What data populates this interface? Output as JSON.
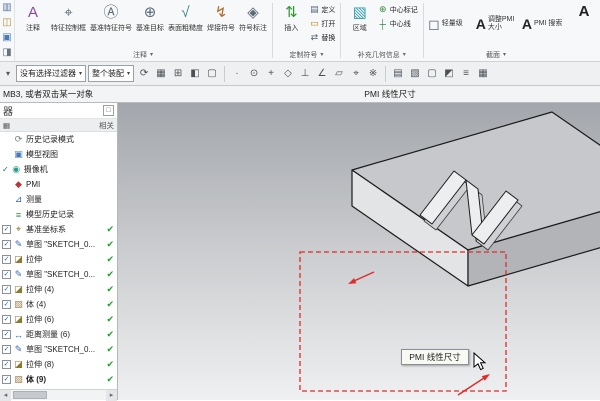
{
  "ribbon": {
    "mini_icons": [
      {
        "icon": "new-part-icon",
        "glyph": "▥",
        "color": "#5b78a8"
      },
      {
        "icon": "open-part-icon",
        "glyph": "◫",
        "color": "#b8913a"
      },
      {
        "icon": "save-part-icon",
        "glyph": "▣",
        "color": "#4a7ab5"
      },
      {
        "icon": "window-switch-icon",
        "glyph": "◨",
        "color": "#6b7480"
      }
    ],
    "annotation_group": {
      "label": "注释",
      "items": [
        {
          "name": "annotation-note-button",
          "icon": "note-a-icon",
          "glyph": "A",
          "color": "#8a4a9a",
          "label": "注释"
        },
        {
          "name": "feature-control-frame-button",
          "icon": "feature-control-frame-icon",
          "glyph": "⌖",
          "color": "#5b6b7a",
          "label": "特征控制框"
        },
        {
          "name": "datum-feature-symbol-button",
          "icon": "datum-feature-icon",
          "glyph": "Ⓐ",
          "color": "#5b6b7a",
          "label": "基准特征符号"
        },
        {
          "name": "datum-target-button",
          "icon": "datum-target-icon",
          "glyph": "⊕",
          "color": "#5b6b7a",
          "label": "基准目标"
        },
        {
          "name": "surface-finish-button",
          "icon": "surface-finish-icon",
          "glyph": "√",
          "color": "#3a8a8a",
          "label": "表面粗糙度"
        },
        {
          "name": "weld-symbol-button",
          "icon": "weld-symbol-icon",
          "glyph": "↯",
          "color": "#b06a2a",
          "label": "焊接符号"
        },
        {
          "name": "symbol-callout-button",
          "icon": "symbol-callout-icon",
          "glyph": "◈",
          "color": "#5b6b7a",
          "label": "符号标注"
        }
      ]
    },
    "custom_symbol_group": {
      "label": "定制符号",
      "big": {
        "label": "插入",
        "glyph": "⇅",
        "color": "#2e9a2e"
      },
      "small_items": [
        {
          "name": "define-symbol-button",
          "icon": "define-icon",
          "glyph": "▤",
          "color": "#55657a",
          "label": "定义"
        },
        {
          "name": "open-symbol-button",
          "icon": "open-icon",
          "glyph": "▭",
          "color": "#b8860b",
          "label": "打开"
        },
        {
          "name": "replace-symbol-button",
          "icon": "replace-icon",
          "glyph": "⇄",
          "color": "#55657a",
          "label": "替换"
        }
      ]
    },
    "supplemental_group": {
      "label": "补充几何信息",
      "big": {
        "label": "区域",
        "glyph": "▧",
        "color": "#2e9bb0"
      },
      "small_items": [
        {
          "name": "center-mark-button",
          "icon": "center-mark-icon",
          "glyph": "⊕",
          "color": "#3a8a44",
          "label": "中心标记"
        },
        {
          "name": "centerline-button",
          "icon": "centerline-icon",
          "glyph": "┼",
          "color": "#3a8a44",
          "label": "中心线"
        }
      ]
    },
    "section_group": {
      "label": "截面",
      "items": [
        {
          "name": "lightweight-button",
          "icon": "lightweight-icon",
          "glyph": "◻",
          "color": "#55657a",
          "label": "轻量级"
        },
        {
          "name": "resize-pmi-button",
          "icon": "resize-pmi-a-icon",
          "glyph": "A",
          "color": "#222222",
          "label": "调整PMI 大小"
        },
        {
          "name": "pmi-search-button",
          "icon": "pmi-search-a-icon",
          "glyph": "A",
          "color": "#222222",
          "label": "PMI 搜索"
        }
      ]
    },
    "edge_item": {
      "glyph": "A"
    }
  },
  "toolbar2": {
    "menu_icon_glyph": "▾",
    "filter_dropdown": "没有选择过滤器",
    "scope_dropdown": "整个装配",
    "icons_a": [
      {
        "icon": "refresh-fit-icon",
        "glyph": "⟳"
      },
      {
        "icon": "shaded-display-icon",
        "glyph": "▦"
      },
      {
        "icon": "window-tile-icon",
        "glyph": "⊞"
      },
      {
        "icon": "half-shade-icon",
        "glyph": "◧"
      },
      {
        "icon": "wireframe-icon",
        "glyph": "▢"
      }
    ],
    "snap_icons": [
      {
        "icon": "snap-point-icon",
        "glyph": "∙"
      },
      {
        "icon": "snap-endpoint-icon",
        "glyph": "⊙"
      },
      {
        "icon": "snap-intersection-icon",
        "glyph": "+"
      },
      {
        "icon": "snap-midpoint-icon",
        "glyph": "◇"
      },
      {
        "icon": "snap-perpendicular-icon",
        "glyph": "⊥"
      },
      {
        "icon": "snap-angle-icon",
        "glyph": "∠"
      },
      {
        "icon": "snap-face-icon",
        "glyph": "▱"
      },
      {
        "icon": "snap-center-icon",
        "glyph": "⌖"
      },
      {
        "icon": "snap-reference-icon",
        "glyph": "※"
      }
    ],
    "icons_b": [
      {
        "icon": "datum-plane-icon",
        "glyph": "▤"
      },
      {
        "icon": "hatch-icon",
        "glyph": "▧"
      },
      {
        "icon": "plane-icon",
        "glyph": "▢"
      },
      {
        "icon": "corner-view-icon",
        "glyph": "◩"
      },
      {
        "icon": "list-view-icon",
        "glyph": "≡"
      },
      {
        "icon": "grid-icon",
        "glyph": "▦"
      }
    ]
  },
  "status_bar": {
    "prompt": "MB3, 或者双击某一对象",
    "title": "PMI 线性尺寸"
  },
  "navigator": {
    "title": "器",
    "column": "相关",
    "rows": [
      {
        "name": "tree-item-history-mode",
        "section": true,
        "icon": "history-mode-icon",
        "glyph": "⟳",
        "color": "#6a7a8a",
        "label": "历史记录模式"
      },
      {
        "name": "tree-item-model-views",
        "section": true,
        "icon": "model-views-icon",
        "glyph": "▣",
        "color": "#4477bb",
        "label": "模型视图"
      },
      {
        "name": "tree-item-cameras",
        "pre": "✓",
        "icon": "camera-icon",
        "glyph": "◉",
        "color": "#2a9a8a",
        "label": "摄像机"
      },
      {
        "name": "tree-item-pmi",
        "section": true,
        "icon": "pmi-icon",
        "glyph": "◆",
        "color": "#bb3333",
        "label": "PMI"
      },
      {
        "name": "tree-item-measure",
        "section": true,
        "icon": "measure-icon",
        "glyph": "⊿",
        "color": "#3366bb",
        "label": "测量"
      },
      {
        "name": "tree-item-model-history",
        "section": true,
        "icon": "model-history-icon",
        "glyph": "≡",
        "color": "#3a8a44",
        "label": "模型历史记录"
      },
      {
        "name": "tree-item-datum-csys",
        "checkbox": true,
        "ok": true,
        "icon": "datum-csys-icon",
        "glyph": "⌖",
        "color": "#8a7a2a",
        "label": "基准坐标系"
      },
      {
        "name": "tree-item-sketch-1",
        "checkbox": true,
        "ok": true,
        "icon": "sketch-icon",
        "glyph": "✎",
        "color": "#3366bb",
        "label": "草图 \"SKETCH_0..."
      },
      {
        "name": "tree-item-extrude-2",
        "checkbox": true,
        "ok": true,
        "icon": "extrude-icon",
        "glyph": "◪",
        "color": "#8a7a30",
        "label": "拉伸"
      },
      {
        "name": "tree-item-sketch-3",
        "checkbox": true,
        "ok": true,
        "icon": "sketch-icon",
        "glyph": "✎",
        "color": "#3366bb",
        "label": "草图 \"SKETCH_0..."
      },
      {
        "name": "tree-item-extrude-4",
        "checkbox": true,
        "ok": true,
        "icon": "extrude-icon",
        "glyph": "◪",
        "color": "#8a7a30",
        "label": "拉伸 (4)"
      },
      {
        "name": "tree-item-body-4",
        "checkbox": true,
        "ok": true,
        "icon": "body-icon",
        "glyph": "▧",
        "color": "#a08050",
        "label": "体 (4)"
      },
      {
        "name": "tree-item-extrude-6",
        "checkbox": true,
        "ok": true,
        "icon": "extrude-icon",
        "glyph": "◪",
        "color": "#8a7a30",
        "label": "拉伸 (6)"
      },
      {
        "name": "tree-item-distance-measure",
        "checkbox": true,
        "ok": true,
        "icon": "distance-measure-icon",
        "glyph": "↔",
        "color": "#3366bb",
        "label": "距离测量 (6)"
      },
      {
        "name": "tree-item-sketch-7",
        "checkbox": true,
        "ok": true,
        "icon": "sketch-icon",
        "glyph": "✎",
        "color": "#3366bb",
        "label": "草图 \"SKETCH_0..."
      },
      {
        "name": "tree-item-extrude-8",
        "checkbox": true,
        "ok": true,
        "icon": "extrude-icon",
        "glyph": "◪",
        "color": "#8a7a30",
        "label": "拉伸 (8)"
      },
      {
        "name": "tree-item-body-9",
        "checkbox": true,
        "ok": true,
        "bold": true,
        "icon": "body-icon",
        "glyph": "▧",
        "color": "#a08050",
        "label": "体 (9)"
      }
    ]
  },
  "viewport": {
    "tooltip": "PMI 线性尺寸"
  }
}
